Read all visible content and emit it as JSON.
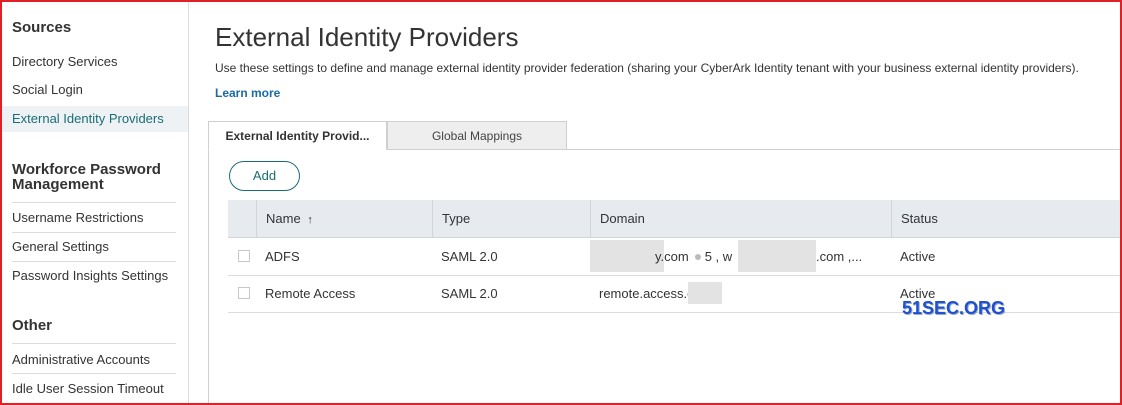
{
  "sidebar": {
    "sections": [
      {
        "title": "Sources",
        "items": [
          "Directory Services",
          "Social Login",
          "External Identity Providers"
        ]
      },
      {
        "title_line1": "Workforce Password",
        "title_line2": "Management",
        "items": [
          "Username Restrictions",
          "General Settings",
          "Password Insights Settings"
        ]
      },
      {
        "title": "Other",
        "items": [
          "Administrative Accounts",
          "Idle User Session Timeout"
        ]
      }
    ],
    "active_item": "External Identity Providers"
  },
  "main": {
    "title": "External Identity Providers",
    "description": "Use these settings to define and manage external identity provider federation (sharing your CyberArk Identity tenant with your business external identity providers).",
    "learn_more": "Learn more",
    "tabs": [
      {
        "label": "External Identity Provid...",
        "active": true
      },
      {
        "label": "Global Mappings",
        "active": false
      }
    ],
    "add_label": "Add",
    "table": {
      "columns": [
        "Name",
        "Type",
        "Domain",
        "Status"
      ],
      "sort_indicator": "↑",
      "rows": [
        {
          "name": "ADFS",
          "type": "SAML 2.0",
          "domain_part1": "y.com",
          "domain_count": "5 , w",
          "domain_part2": ".com ,...",
          "status": "Active"
        },
        {
          "name": "Remote Access",
          "type": "SAML 2.0",
          "domain": "remote.access.e",
          "status": "Active"
        }
      ]
    }
  },
  "watermark": "51SEC.ORG",
  "colors": {
    "accent": "#1a6e73",
    "link": "#1a6aa6",
    "frame": "#e01f26"
  }
}
